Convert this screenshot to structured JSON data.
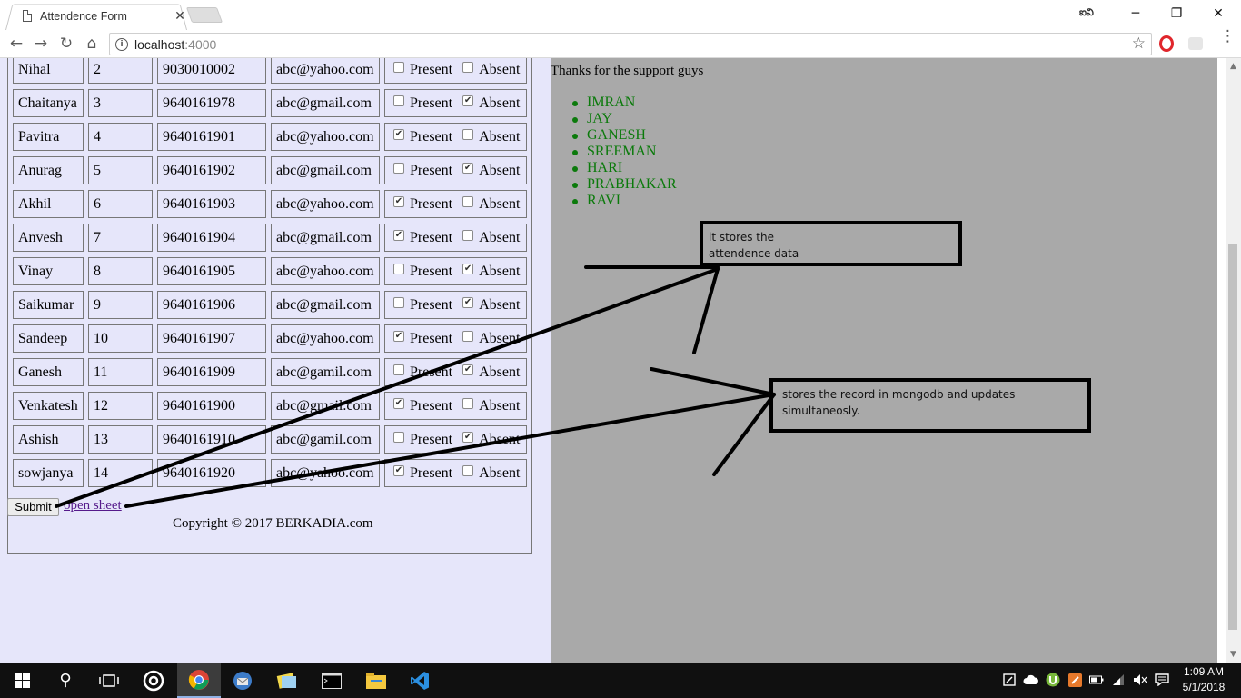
{
  "browser": {
    "tab_title": "Attendence Form",
    "tab_close": "✕",
    "profile": "ఐవి",
    "window_buttons": {
      "minimize": "─",
      "restore": "❐",
      "close": "✕"
    },
    "nav": {
      "back": "←",
      "forward": "→",
      "reload": "↻",
      "home": "⌂"
    },
    "url_host": "localhost",
    "url_port": ":4000",
    "info_glyph": "i",
    "star_glyph": "☆",
    "menu_glyph": "⋮"
  },
  "form": {
    "present_label": "Present",
    "absent_label": "Absent",
    "rows": [
      {
        "name": "Nihal",
        "roll": "2",
        "phone": "9030010002",
        "email": "abc@yahoo.com",
        "present": false,
        "absent": false
      },
      {
        "name": "Chaitanya",
        "roll": "3",
        "phone": "9640161978",
        "email": "abc@gmail.com",
        "present": false,
        "absent": true
      },
      {
        "name": "Pavitra",
        "roll": "4",
        "phone": "9640161901",
        "email": "abc@yahoo.com",
        "present": true,
        "absent": false
      },
      {
        "name": "Anurag",
        "roll": "5",
        "phone": "9640161902",
        "email": "abc@gmail.com",
        "present": false,
        "absent": true
      },
      {
        "name": "Akhil",
        "roll": "6",
        "phone": "9640161903",
        "email": "abc@yahoo.com",
        "present": true,
        "absent": false
      },
      {
        "name": "Anvesh",
        "roll": "7",
        "phone": "9640161904",
        "email": "abc@gmail.com",
        "present": true,
        "absent": false
      },
      {
        "name": "Vinay",
        "roll": "8",
        "phone": "9640161905",
        "email": "abc@yahoo.com",
        "present": false,
        "absent": true
      },
      {
        "name": "Saikumar",
        "roll": "9",
        "phone": "9640161906",
        "email": "abc@gmail.com",
        "present": false,
        "absent": true
      },
      {
        "name": "Sandeep",
        "roll": "10",
        "phone": "9640161907",
        "email": "abc@yahoo.com",
        "present": true,
        "absent": false
      },
      {
        "name": "Ganesh",
        "roll": "11",
        "phone": "9640161909",
        "email": "abc@gamil.com",
        "present": false,
        "absent": true
      },
      {
        "name": "Venkatesh",
        "roll": "12",
        "phone": "9640161900",
        "email": "abc@gmail.com",
        "present": true,
        "absent": false
      },
      {
        "name": "Ashish",
        "roll": "13",
        "phone": "9640161910",
        "email": "abc@gamil.com",
        "present": false,
        "absent": true
      },
      {
        "name": "sowjanya",
        "roll": "14",
        "phone": "9640161920",
        "email": "abc@yahoo.com",
        "present": true,
        "absent": false
      }
    ],
    "submit_label": "Submit",
    "open_sheet_label": "open sheet",
    "copyright": "Copyright © 2017 BERKADIA.com"
  },
  "support": {
    "thanks": "Thanks for the support guys",
    "names": [
      "IMRAN",
      "JAY",
      "GANESH",
      "SREEMAN",
      "HARI",
      "PRABHAKAR",
      "RAVI"
    ],
    "name_color": "#0b7a0b"
  },
  "annotations": {
    "box1_line1": "it stores the",
    "box1_line2": "attendence  data",
    "box2_line1": "stores the record in mongodb and updates",
    "box2_line2": "simultaneosly."
  },
  "colors": {
    "form_bg": "#e6e6fa",
    "right_bg": "#a9a9a9",
    "link": "#551a8b"
  },
  "taskbar": {
    "start_icon": "windows-icon",
    "search_glyph": "⚲",
    "time": "1:09 AM",
    "date": "5/1/2018"
  }
}
